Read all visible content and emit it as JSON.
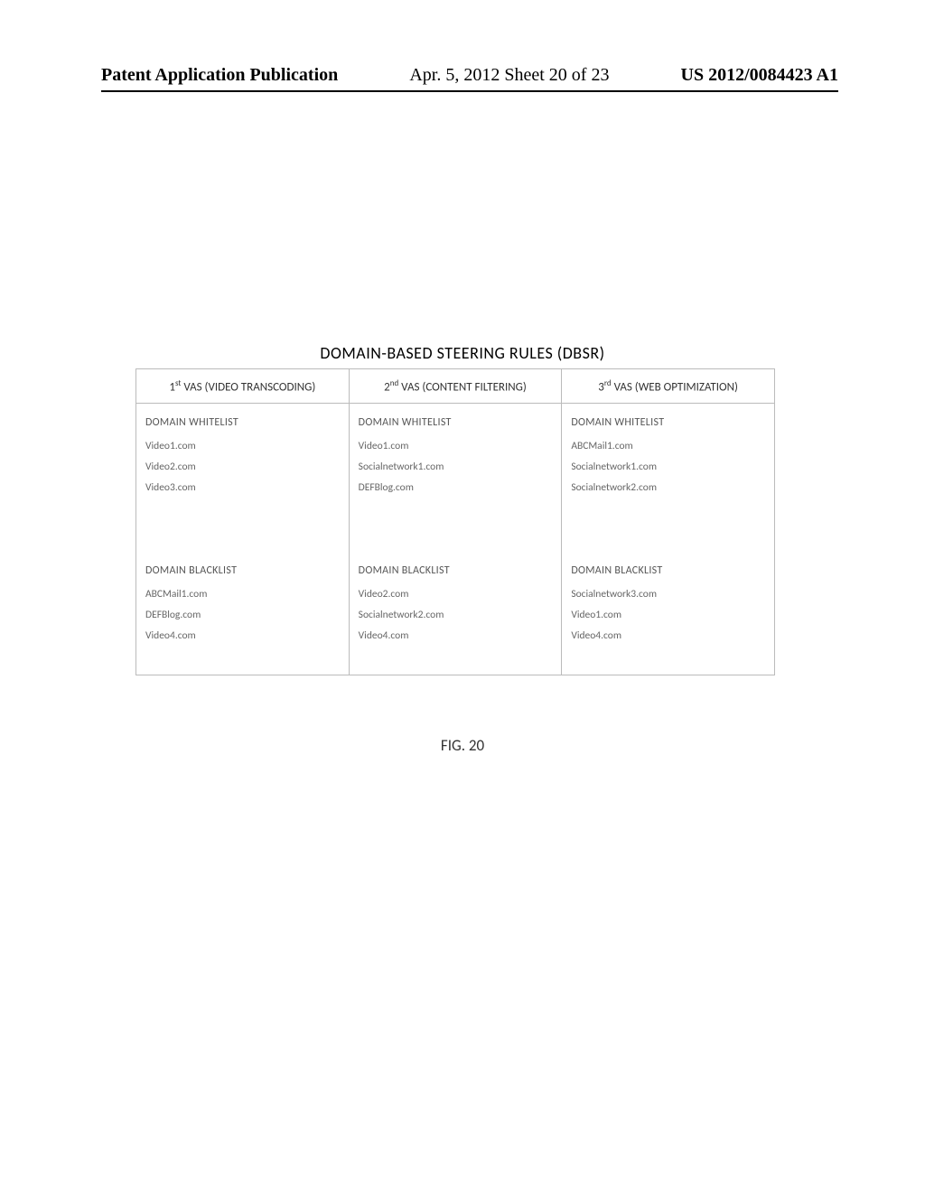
{
  "header": {
    "left": "Patent Application Publication",
    "center": "Apr. 5, 2012  Sheet 20 of 23",
    "right": "US 2012/0084423 A1"
  },
  "figure": {
    "title": "DOMAIN-BASED STEERING RULES (DBSR)",
    "caption": "FIG. 20"
  },
  "table": {
    "columns": [
      {
        "ord": "st",
        "num": "1",
        "label": " VAS (VIDEO TRANSCODING)"
      },
      {
        "ord": "nd",
        "num": "2",
        "label": " VAS (CONTENT FILTERING)"
      },
      {
        "ord": "rd",
        "num": "3",
        "label": " VAS (WEB OPTIMIZATION)"
      }
    ],
    "whitelist_label": "DOMAIN WHITELIST",
    "blacklist_label": "DOMAIN BLACKLIST",
    "cells": [
      {
        "whitelist": [
          "Video1.com",
          "Video2.com",
          "Video3.com"
        ],
        "blacklist": [
          "ABCMail1.com",
          "DEFBlog.com",
          "Video4.com"
        ]
      },
      {
        "whitelist": [
          "Video1.com",
          "Socialnetwork1.com",
          "DEFBlog.com"
        ],
        "blacklist": [
          "Video2.com",
          "Socialnetwork2.com",
          "Video4.com"
        ]
      },
      {
        "whitelist": [
          "ABCMail1.com",
          "Socialnetwork1.com",
          "Socialnetwork2.com"
        ],
        "blacklist": [
          "Socialnetwork3.com",
          "Video1.com",
          "Video4.com"
        ]
      }
    ]
  }
}
